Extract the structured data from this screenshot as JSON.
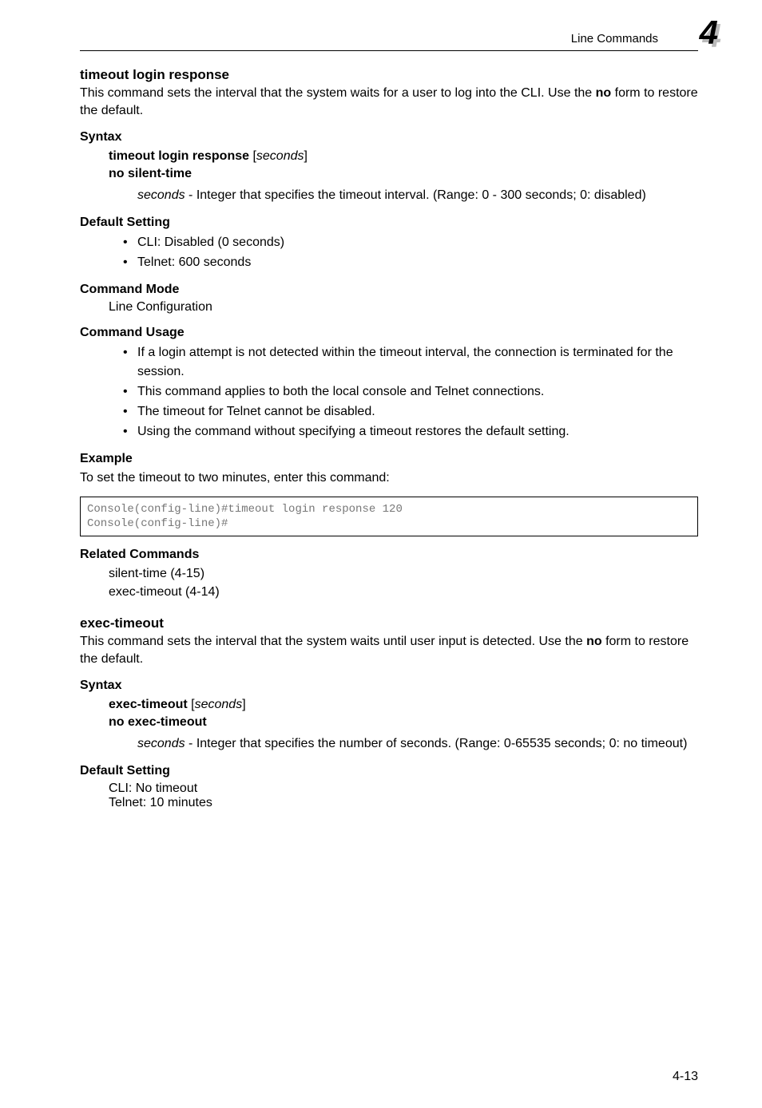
{
  "header": {
    "section": "Line Commands",
    "chapter": "4"
  },
  "s1": {
    "title": "timeout login response",
    "intro1": "This command sets the interval that the system waits for a user to log into the CLI. Use the ",
    "intro_bold": "no",
    "intro2": " form to restore the default.",
    "syntax_label": "Syntax",
    "syntax_line1_b": "timeout login response",
    "syntax_line1_rest": " [",
    "syntax_line1_i": "seconds",
    "syntax_line1_end": "]",
    "syntax_line2": "no silent-time",
    "syntax_desc_i": "seconds",
    "syntax_desc_rest": " - Integer that specifies the timeout interval. (Range: 0 - 300 seconds; 0: disabled)",
    "default_label": "Default Setting",
    "default_b1": "CLI: Disabled (0 seconds)",
    "default_b2": "Telnet: 600 seconds",
    "mode_label": "Command Mode",
    "mode_text": "Line Configuration",
    "usage_label": "Command Usage",
    "usage_b1": "If a login attempt is not detected within the timeout interval, the connection is terminated for the session.",
    "usage_b2": "This command applies to both the local console and Telnet connections.",
    "usage_b3": "The timeout for Telnet cannot be disabled.",
    "usage_b4": "Using the command without specifying a timeout restores the default setting.",
    "example_label": "Example",
    "example_intro": "To set the timeout to two minutes, enter this command:",
    "example_code": "Console(config-line)#timeout login response 120\nConsole(config-line)#",
    "related_label": "Related Commands",
    "related_1": "silent-time (4-15)",
    "related_2": "exec-timeout (4-14)"
  },
  "s2": {
    "title": "exec-timeout",
    "intro1": "This command sets the interval that the system waits until user input is detected. Use the ",
    "intro_bold": "no",
    "intro2": " form to restore the default.",
    "syntax_label": "Syntax",
    "syntax_line1_b": "exec-timeout",
    "syntax_line1_rest": " [",
    "syntax_line1_i": "seconds",
    "syntax_line1_end": "]",
    "syntax_line2": "no exec-timeout",
    "syntax_desc_i": "seconds",
    "syntax_desc_rest": " - Integer that specifies the number of seconds. (Range: 0-65535 seconds; 0: no timeout)",
    "default_label": "Default Setting",
    "default_line1": "CLI: No timeout",
    "default_line2": "Telnet: 10 minutes"
  },
  "footer": {
    "page": "4-13"
  }
}
